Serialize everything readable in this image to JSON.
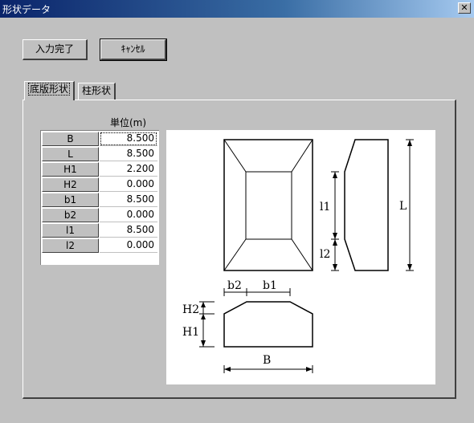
{
  "window": {
    "title": "形状データ",
    "close_symbol": "✕"
  },
  "buttons": {
    "ok_label": "入力完了",
    "cancel_label": "ｷｬﾝｾﾙ"
  },
  "tabs": [
    {
      "label": "底版形状",
      "active": true
    },
    {
      "label": "柱形状",
      "active": false
    }
  ],
  "grid": {
    "unit_header": "単位(m)",
    "rows": [
      {
        "name": "B",
        "value": "8.500"
      },
      {
        "name": "L",
        "value": "8.500"
      },
      {
        "name": "H1",
        "value": "2.200"
      },
      {
        "name": "H2",
        "value": "0.000"
      },
      {
        "name": "b1",
        "value": "8.500"
      },
      {
        "name": "b2",
        "value": "0.000"
      },
      {
        "name": "l1",
        "value": "8.500"
      },
      {
        "name": "l2",
        "value": "0.000"
      }
    ]
  },
  "diagram": {
    "labels": {
      "l1": "l1",
      "l2": "l2",
      "L": "L",
      "b2": "b2",
      "b1": "b1",
      "H2": "H2",
      "H1": "H1",
      "B": "B"
    }
  }
}
